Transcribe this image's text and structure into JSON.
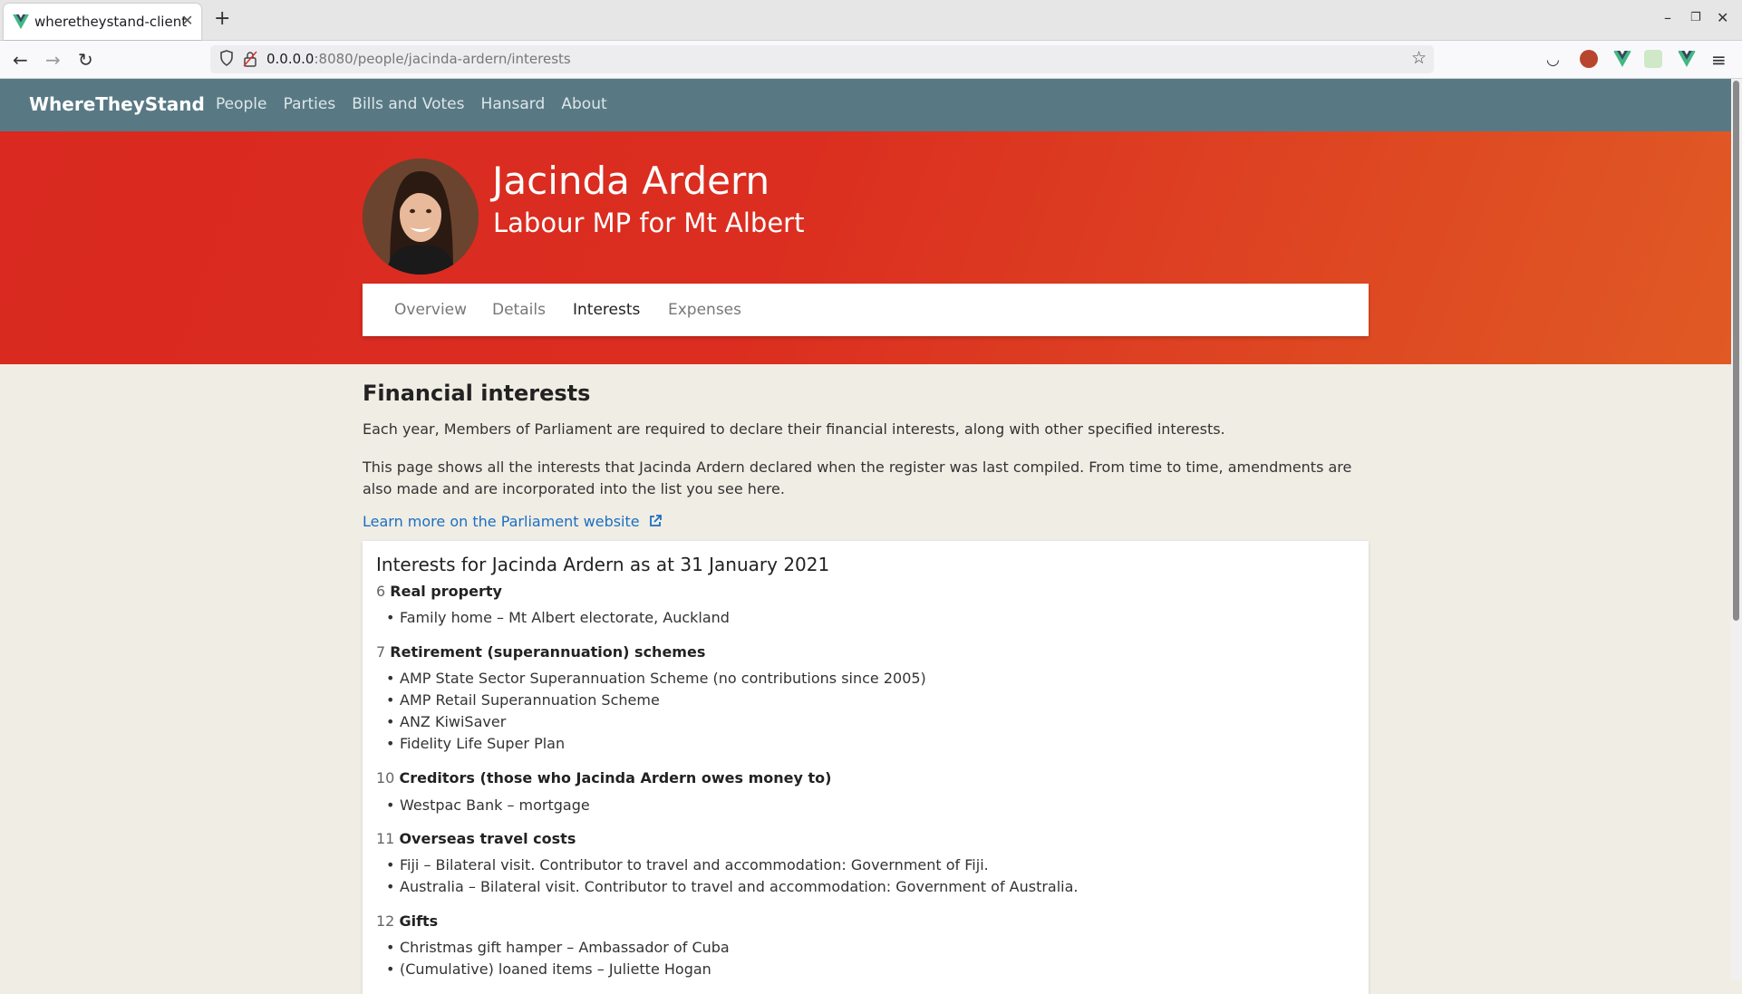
{
  "browser": {
    "tab_title": "wheretheystand-client",
    "url_host": "0.0.0.0",
    "url_rest": ":8080/people/jacinda-ardern/interests"
  },
  "site": {
    "brand": "WhereTheyStand",
    "nav": [
      "People",
      "Parties",
      "Bills and Votes",
      "Hansard",
      "About"
    ]
  },
  "person": {
    "name": "Jacinda Ardern",
    "role": "Labour MP for Mt Albert"
  },
  "tabs": [
    "Overview",
    "Details",
    "Interests",
    "Expenses"
  ],
  "active_tab": "Interests",
  "page": {
    "heading": "Financial interests",
    "para1": "Each year, Members of Parliament are required to declare their financial interests, along with other specified interests.",
    "para2": "This page shows all the interests that Jacinda Ardern declared when the register was last compiled. From time to time, amendments are also made and are incorporated into the list you see here.",
    "learn_more": "Learn more on the Parliament website"
  },
  "interests": {
    "title": "Interests for Jacinda Ardern as at 31 January 2021",
    "sections": [
      {
        "num": "6",
        "label": "Real property",
        "items": [
          "Family home – Mt Albert electorate, Auckland"
        ]
      },
      {
        "num": "7",
        "label": "Retirement (superannuation) schemes",
        "items": [
          "AMP State Sector Superannuation Scheme (no contributions since 2005)",
          "AMP Retail Superannuation Scheme",
          "ANZ KiwiSaver",
          "Fidelity Life Super Plan"
        ]
      },
      {
        "num": "10",
        "label": "Creditors (those who Jacinda Ardern owes money to)",
        "items": [
          "Westpac Bank – mortgage"
        ]
      },
      {
        "num": "11",
        "label": "Overseas travel costs",
        "items": [
          "Fiji – Bilateral visit. Contributor to travel and accommodation: Government of Fiji.",
          "Australia – Bilateral visit. Contributor to travel and accommodation: Government of Australia."
        ]
      },
      {
        "num": "12",
        "label": "Gifts",
        "items": [
          "Christmas gift hamper – Ambassador of Cuba",
          "(Cumulative) loaned items – Juliette Hogan"
        ]
      }
    ]
  },
  "colors": {
    "header": "#587984",
    "hero_red": "#d92920",
    "hero_orange": "#e05a24",
    "link": "#1b6fc2",
    "page_bg": "#f0ede4"
  }
}
